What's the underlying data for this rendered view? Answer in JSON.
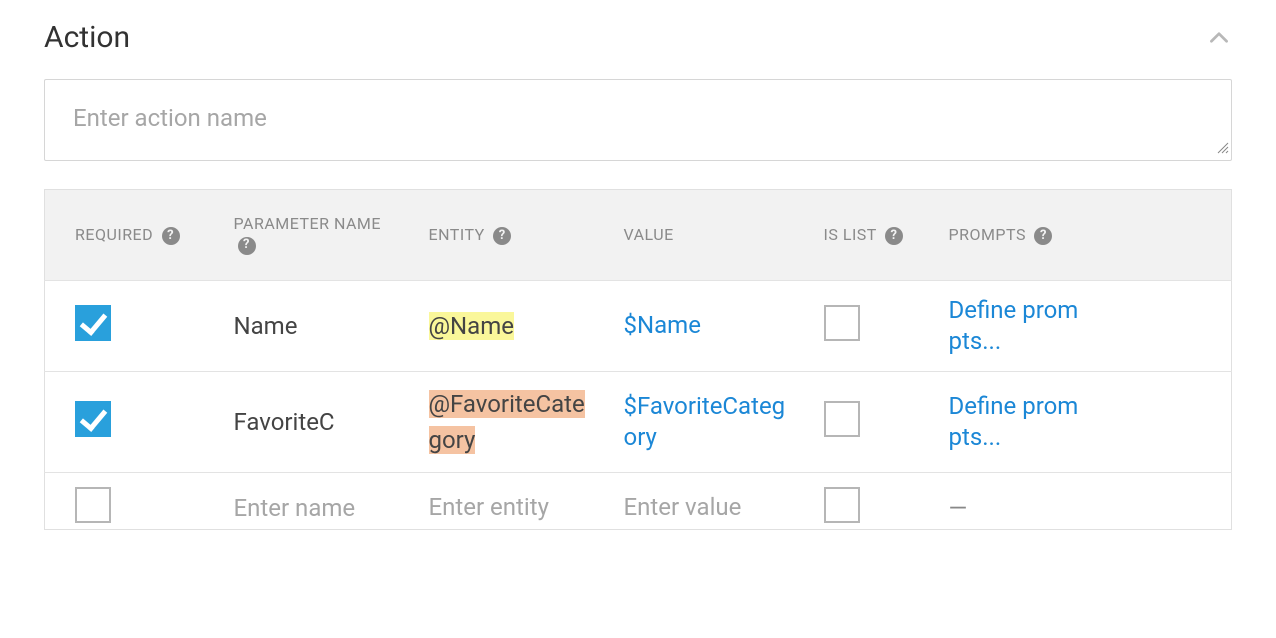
{
  "section": {
    "title": "Action"
  },
  "actionName": {
    "placeholder": "Enter action name",
    "value": ""
  },
  "table": {
    "headers": {
      "required": "REQUIRED",
      "parameterName": "PARAMETER NAME",
      "entity": "ENTITY",
      "value": "VALUE",
      "isList": "IS LIST",
      "prompts": "PROMPTS"
    },
    "rows": [
      {
        "required": true,
        "parameterName": "Name",
        "entity": "@Name",
        "entityHighlight": "yellow",
        "value": "$Name",
        "isList": false,
        "prompts": "Define prompts..."
      },
      {
        "required": true,
        "parameterName": "FavoriteC",
        "entity": "@FavoriteCategory",
        "entityHighlight": "orange",
        "value": "$FavoriteCategory",
        "isList": false,
        "prompts": "Define prompts..."
      }
    ],
    "newRow": {
      "parameterNamePlaceholder": "Enter name",
      "entityPlaceholder": "Enter entity",
      "valuePlaceholder": "Enter value",
      "promptsPlaceholder": "—"
    }
  },
  "colors": {
    "linkBlue": "#1b87d6",
    "checkboxBlue": "#29a0dc",
    "highlightYellow": "#faf79a",
    "highlightOrange": "#f5c3a2"
  }
}
